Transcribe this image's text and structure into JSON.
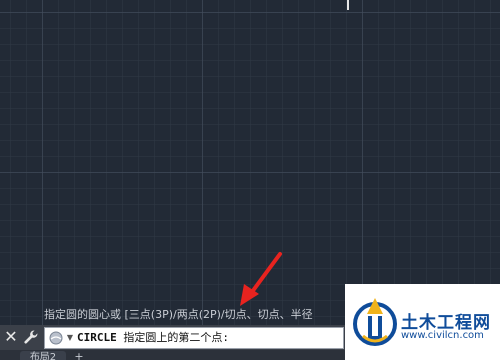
{
  "command_line": {
    "history": "指定圆的圆心或 [三点(3P)/两点(2P)/切点、切点、半径",
    "command_name": "CIRCLE",
    "prompt": "指定圆上的第二个点:",
    "close_label": "✕",
    "customize_icon": "wrench-icon"
  },
  "layout_tabs": {
    "tabs": [
      {
        "label": "布局2"
      }
    ],
    "add_label": "+"
  },
  "annotation": {
    "arrow_color": "#e8231f"
  },
  "watermark": {
    "title": "土木工程网",
    "url": "www.civilcn.com",
    "brand_color": "#0f4c9a"
  },
  "colors": {
    "canvas_background": "#222a36",
    "command_bar": "#3b4049"
  }
}
